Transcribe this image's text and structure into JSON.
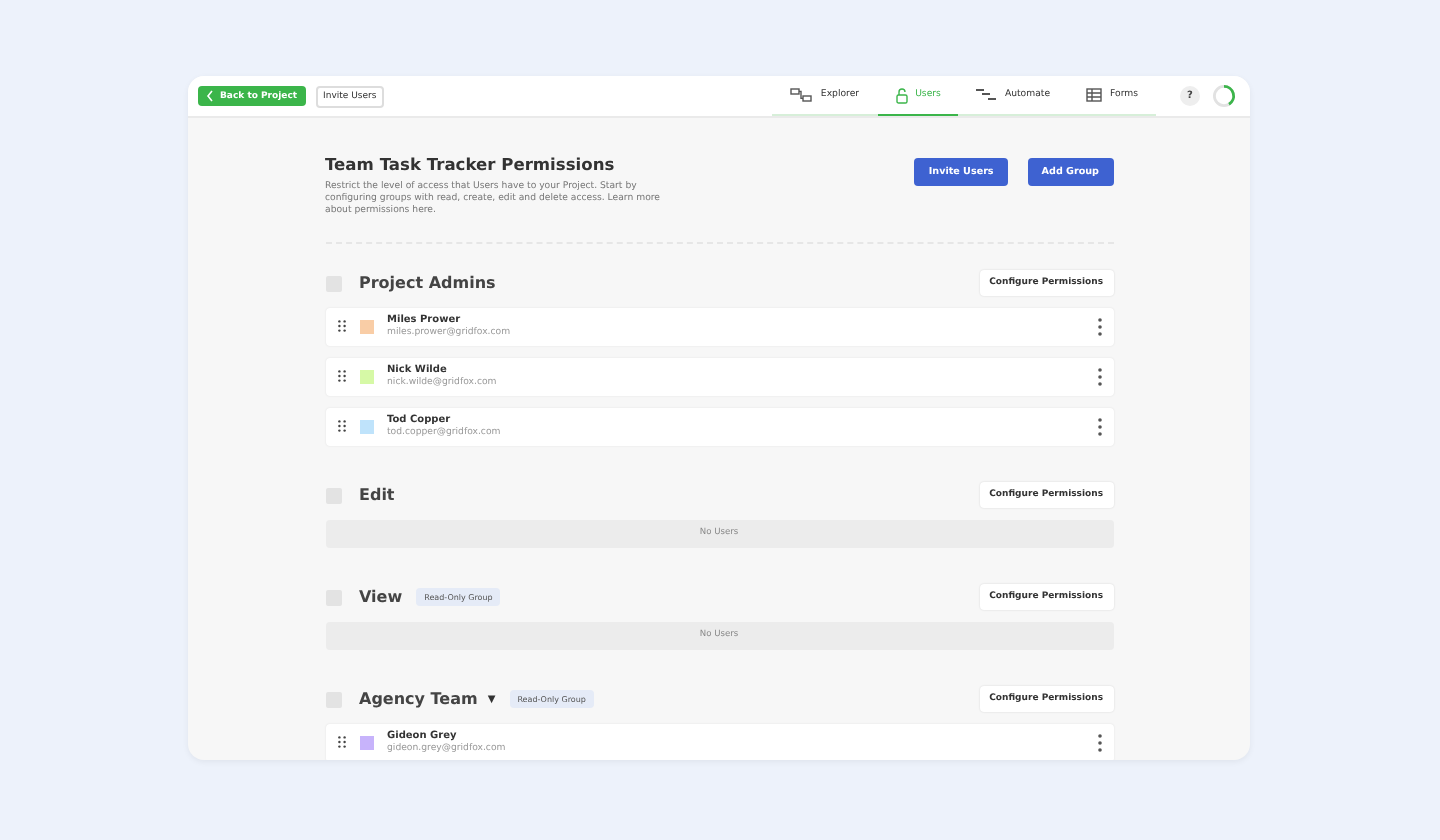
{
  "topbar": {
    "back_button": "Back to Project",
    "invite_button": "Invite Users",
    "tabs": [
      {
        "label": "Explorer",
        "kind": "explorer",
        "selected": false
      },
      {
        "label": "Users",
        "kind": "users",
        "selected": true
      },
      {
        "label": "Automate",
        "kind": "automate",
        "selected": false
      },
      {
        "label": "Forms",
        "kind": "forms",
        "selected": false
      }
    ],
    "help_button": "?"
  },
  "header": {
    "title": "Team Task Tracker Permissions",
    "description": "Restrict the level of access that Users have to your Project. Start by configuring groups with read, create, edit and delete access. Learn more about permissions here.",
    "buttons": [
      "Invite Users",
      "Add Group"
    ]
  },
  "groups": [
    {
      "name": "Project Admins",
      "checked": false,
      "configure": "Configure Permissions",
      "users": [
        {
          "name": "Miles Prower",
          "email": "miles.prower@gridfox.com",
          "color": "#f9cda6"
        },
        {
          "name": "Nick Wilde",
          "email": "nick.wilde@gridfox.com",
          "color": "#d6f9a6"
        },
        {
          "name": "Tod Copper",
          "email": "tod.copper@gridfox.com",
          "color": "#bfe3fb"
        }
      ]
    },
    {
      "name": "Edit",
      "checked": false,
      "configure": "Configure Permissions",
      "empty_text": "No Users"
    },
    {
      "name": "View",
      "checked": false,
      "badge": "Read-Only Group",
      "configure": "Configure Permissions",
      "empty_text": "No Users"
    },
    {
      "name": "Agency Team",
      "caret": "▼",
      "checked": false,
      "badge": "Read-Only Group",
      "configure": "Configure Permissions",
      "users": [
        {
          "name": "Gideon Grey",
          "email": "gideon.grey@gridfox.com",
          "color": "#c7b3fb"
        }
      ]
    }
  ]
}
